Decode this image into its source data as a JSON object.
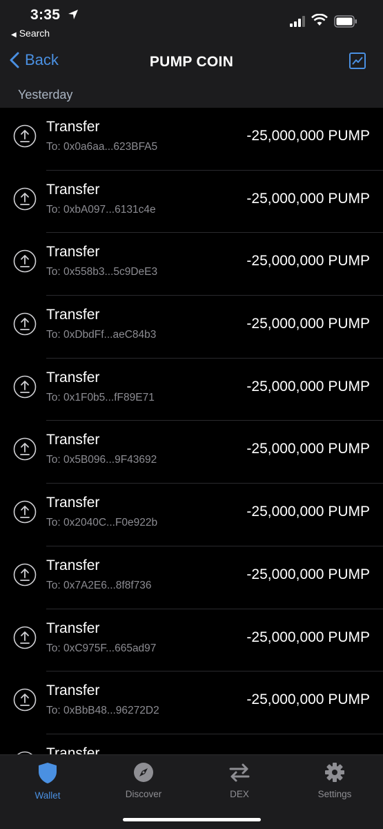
{
  "status_bar": {
    "time": "3:35",
    "back_app_label": "Search",
    "icons": [
      "location-arrow-icon",
      "signal-icon",
      "wifi-icon",
      "battery-icon"
    ]
  },
  "nav": {
    "back_label": "Back",
    "title": "PUMP COIN",
    "chart_icon": "chart-icon"
  },
  "section_header": "Yesterday",
  "transactions": [
    {
      "title": "Transfer",
      "address": "To: 0x0a6aa...623BFA5",
      "amount": "-25,000,000 PUMP"
    },
    {
      "title": "Transfer",
      "address": "To: 0xbA097...6131c4e",
      "amount": "-25,000,000 PUMP"
    },
    {
      "title": "Transfer",
      "address": "To: 0x558b3...5c9DeE3",
      "amount": "-25,000,000 PUMP"
    },
    {
      "title": "Transfer",
      "address": "To: 0xDbdFf...aeC84b3",
      "amount": "-25,000,000 PUMP"
    },
    {
      "title": "Transfer",
      "address": "To: 0x1F0b5...fF89E71",
      "amount": "-25,000,000 PUMP"
    },
    {
      "title": "Transfer",
      "address": "To: 0x5B096...9F43692",
      "amount": "-25,000,000 PUMP"
    },
    {
      "title": "Transfer",
      "address": "To: 0x2040C...F0e922b",
      "amount": "-25,000,000 PUMP"
    },
    {
      "title": "Transfer",
      "address": "To: 0x7A2E6...8f8f736",
      "amount": "-25,000,000 PUMP"
    },
    {
      "title": "Transfer",
      "address": "To: 0xC975F...665ad97",
      "amount": "-25,000,000 PUMP"
    },
    {
      "title": "Transfer",
      "address": "To: 0xBbB48...96272D2",
      "amount": "-25,000,000 PUMP"
    },
    {
      "title": "Transfer",
      "address": "",
      "amount": ""
    }
  ],
  "tabs": [
    {
      "label": "Wallet",
      "icon": "shield-icon",
      "active": true
    },
    {
      "label": "Discover",
      "icon": "compass-icon",
      "active": false
    },
    {
      "label": "DEX",
      "icon": "swap-arrows-icon",
      "active": false
    },
    {
      "label": "Settings",
      "icon": "gear-icon",
      "active": false
    }
  ],
  "colors": {
    "accent": "#4a90e2",
    "background": "#000000",
    "bar_background": "#1c1c1e",
    "secondary_text": "#8c8c92"
  }
}
